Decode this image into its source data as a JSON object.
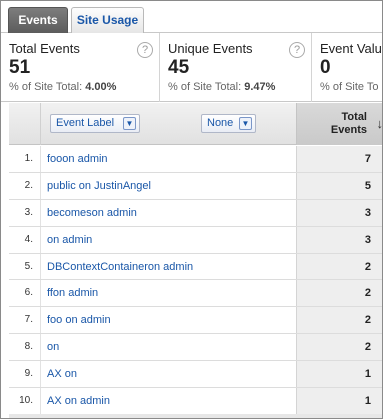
{
  "tabs": [
    {
      "label": "Events"
    },
    {
      "label": "Site Usage"
    }
  ],
  "scorecards": [
    {
      "title": "Total Events",
      "value": "51",
      "sub_prefix": "% of Site Total:",
      "sub_value": "4.00%"
    },
    {
      "title": "Unique Events",
      "value": "45",
      "sub_prefix": "% of Site Total:",
      "sub_value": "9.47%"
    },
    {
      "title": "Event Valu",
      "value": "0",
      "sub_prefix": "% of Site To",
      "sub_value": ""
    }
  ],
  "table": {
    "primary_dimension": "Event Label",
    "secondary_dimension": "None",
    "metric_header": "Total Events",
    "sort_direction": "descending",
    "rows": [
      {
        "index": "1.",
        "label": "fooon admin",
        "total": "7"
      },
      {
        "index": "2.",
        "label": "public on JustinAngel",
        "total": "5"
      },
      {
        "index": "3.",
        "label": "becomeson admin",
        "total": "3"
      },
      {
        "index": "4.",
        "label": "on admin",
        "total": "3"
      },
      {
        "index": "5.",
        "label": "DBContextContaineron admin",
        "total": "2"
      },
      {
        "index": "6.",
        "label": "ffon admin",
        "total": "2"
      },
      {
        "index": "7.",
        "label": "foo on admin",
        "total": "2"
      },
      {
        "index": "8.",
        "label": "on",
        "total": "2"
      },
      {
        "index": "9.",
        "label": "AX on",
        "total": "1"
      },
      {
        "index": "10.",
        "label": "AX on admin",
        "total": "1"
      }
    ]
  },
  "icons": {
    "help": "help-icon",
    "dropdown": "chevron-down-icon",
    "sort": "sort-desc-arrow-icon"
  }
}
